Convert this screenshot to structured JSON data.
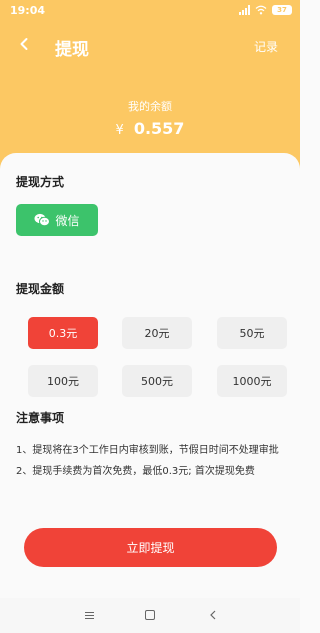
{
  "status_bar": {
    "time": "19:04",
    "battery": "37"
  },
  "header": {
    "title": "提现",
    "record_label": "记录"
  },
  "balance": {
    "label": "我的余额",
    "currency": "¥",
    "value": "0.557"
  },
  "method_section": {
    "title": "提现方式",
    "wechat_label": "微信",
    "wechat_color": "#3cc36b"
  },
  "amount_section": {
    "title": "提现金额",
    "options": [
      "0.3元",
      "20元",
      "50元",
      "100元",
      "500元",
      "1000元"
    ],
    "selected": "0.3元"
  },
  "notice_section": {
    "title": "注意事项",
    "lines": [
      "1、提现将在3个工作日内审核到账，节假日时间不处理审批",
      "2、提现手续费为首次免费，最低0.3元; 首次提现免费"
    ]
  },
  "submit": {
    "label": "立即提现"
  },
  "colors": {
    "header": "#fcc863",
    "accent": "#f04338",
    "wechat": "#3cc36b"
  },
  "navigation": {
    "icons": [
      "menu-icon",
      "home-icon",
      "back-icon"
    ]
  }
}
